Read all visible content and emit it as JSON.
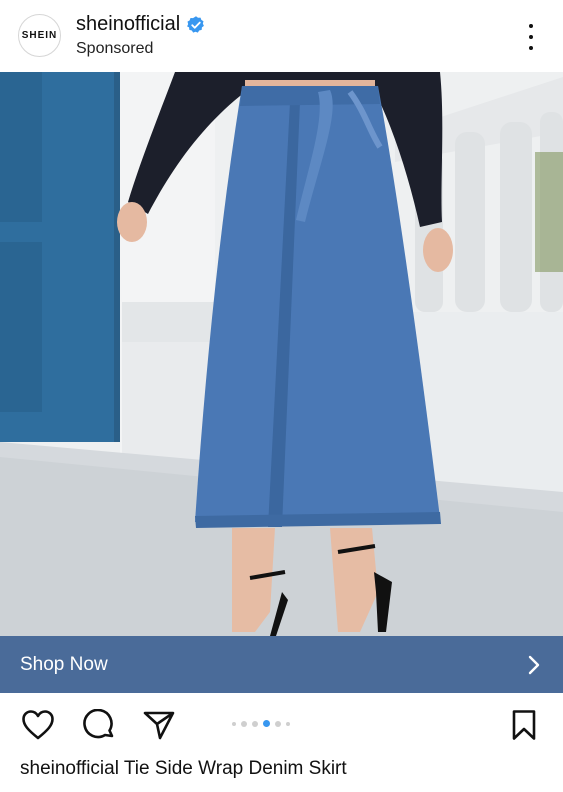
{
  "post": {
    "avatar_text": "SHEIN",
    "username": "sheinofficial",
    "sponsored_label": "Sponsored",
    "verified": true
  },
  "photo": {
    "subject": "Tie Side Wrap Denim Skirt product photo",
    "colors": {
      "door": "#2f6e9e",
      "denim": "#4a78b5",
      "top": "#1c1f2b",
      "wall": "#f2f3f4"
    }
  },
  "cta": {
    "label": "Shop Now",
    "background": "#4a6b99"
  },
  "actions": {
    "like": "heart-icon",
    "comment": "comment-bubble-icon",
    "share": "paper-plane-icon",
    "save": "bookmark-icon",
    "carousel_total": 6,
    "carousel_active_index": 3,
    "active_dot_color": "#3897f0"
  },
  "caption": {
    "username": "sheinofficial",
    "text": "Tie Side Wrap Denim Skirt"
  }
}
